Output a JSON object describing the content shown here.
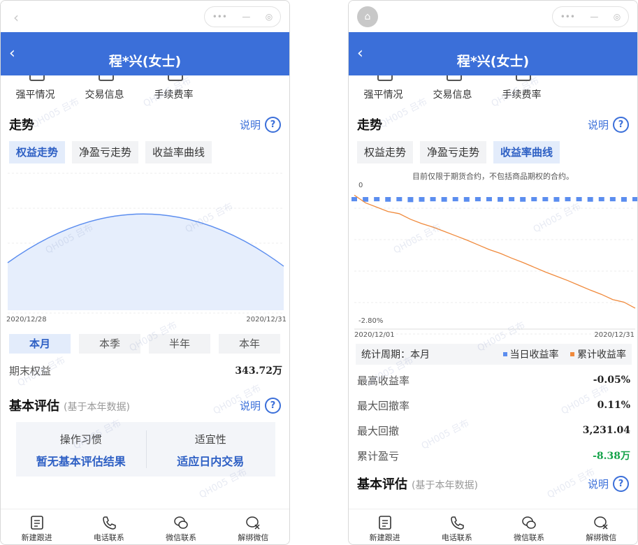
{
  "watermark": "QH005 吕布",
  "header": {
    "title": "程*兴(女士)"
  },
  "quick_links": [
    "强平情况",
    "交易信息",
    "手续费率"
  ],
  "trend": {
    "heading": "走势",
    "explain": "说明",
    "tabs": [
      "权益走势",
      "净盈亏走势",
      "收益率曲线"
    ]
  },
  "left": {
    "active_tab": 0,
    "chart_data": {
      "type": "area",
      "x_start": "2020/12/28",
      "x_end": "2020/12/31",
      "color": "#5b8def",
      "fill": "#e6eefc"
    },
    "periods": [
      "本月",
      "本季",
      "半年",
      "本年"
    ],
    "active_period": 0,
    "end_equity_label": "期末权益",
    "end_equity_value": "343.72万",
    "eval": {
      "heading": "基本评估",
      "sub": "(基于本年数据)",
      "explain": "说明",
      "cols": [
        {
          "label": "操作习惯",
          "value": "暂无基本评估结果"
        },
        {
          "label": "适宜性",
          "value": "适应日内交易"
        }
      ]
    }
  },
  "right": {
    "active_tab": 2,
    "note": "目前仅限于期货合约，不包括商品期权的合约。",
    "chart_data": {
      "type": "line",
      "x_start": "2020/12/01",
      "x_end": "2020/12/31",
      "y_top_label": "0",
      "y_bottom_label": "-2.80%",
      "ylim": [
        -2.8,
        0
      ],
      "series": [
        {
          "name": "当日收益率",
          "color": "#5b8def",
          "values": [
            -0.05,
            -0.06,
            -0.05,
            -0.06,
            -0.05,
            -0.07,
            -0.06,
            -0.05,
            -0.06,
            -0.05,
            -0.06,
            -0.05,
            -0.05,
            -0.06,
            -0.05,
            -0.06,
            -0.05,
            -0.05,
            -0.06,
            -0.05,
            -0.05,
            -0.06,
            -0.05,
            -0.05,
            -0.06,
            -0.05
          ]
        },
        {
          "name": "累计收益率",
          "color": "#f08a3c",
          "values": [
            -0.02,
            -0.2,
            -0.3,
            -0.4,
            -0.45,
            -0.58,
            -0.68,
            -0.76,
            -0.86,
            -0.96,
            -1.06,
            -1.17,
            -1.28,
            -1.37,
            -1.48,
            -1.58,
            -1.69,
            -1.8,
            -1.9,
            -2.0,
            -2.11,
            -2.22,
            -2.32,
            -2.44,
            -2.5,
            -2.64
          ]
        }
      ]
    },
    "stat_period_label": "统计周期：本月",
    "legend": [
      "当日收益率",
      "累计收益率"
    ],
    "stats": [
      {
        "label": "最高收益率",
        "value": "-0.05%"
      },
      {
        "label": "最大回撤率",
        "value": "0.11%"
      },
      {
        "label": "最大回撤",
        "value": "3,231.04"
      },
      {
        "label": "累计盈亏",
        "value": "-8.38万",
        "green": true
      }
    ],
    "eval": {
      "heading": "基本评估",
      "sub": "(基于本年数据)",
      "explain": "说明"
    }
  },
  "bottom_nav": [
    "新建跟进",
    "电话联系",
    "微信联系",
    "解绑微信"
  ]
}
